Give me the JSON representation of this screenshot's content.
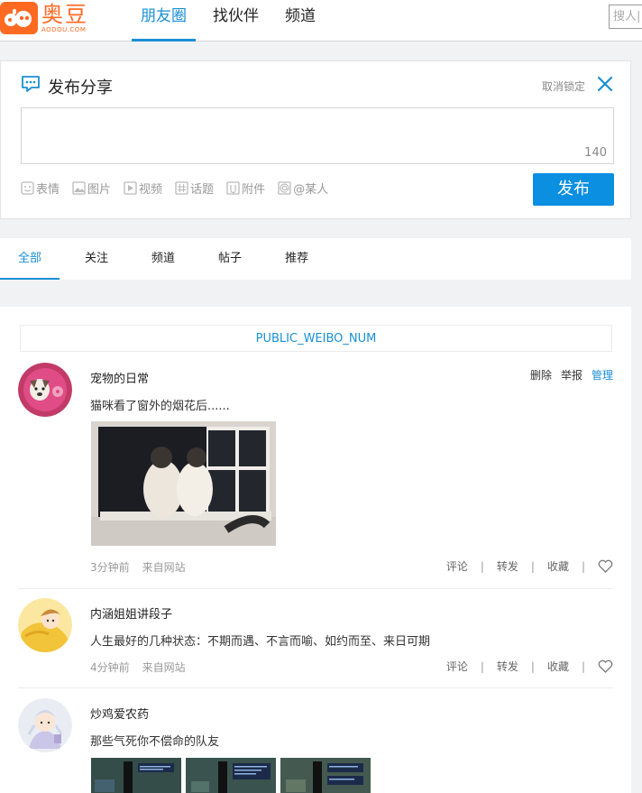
{
  "header": {
    "logo_cn": "奥豆",
    "logo_en": "AODOU.COM",
    "nav": [
      "朋友圈",
      "找伙伴",
      "频道"
    ],
    "search_placeholder": "搜人|"
  },
  "publish": {
    "title": "发布分享",
    "cancel_lock": "取消锁定",
    "counter": "140",
    "tools": [
      {
        "icon": "emoji-icon",
        "label": "表情"
      },
      {
        "icon": "image-icon",
        "label": "图片"
      },
      {
        "icon": "video-icon",
        "label": "视频"
      },
      {
        "icon": "hashtag-icon",
        "label": "话题"
      },
      {
        "icon": "attachment-icon",
        "label": "附件"
      },
      {
        "icon": "at-icon",
        "label": "@某人"
      }
    ],
    "submit_label": "发布"
  },
  "tabs": [
    "全部",
    "关注",
    "频道",
    "帖子",
    "推荐"
  ],
  "feed": {
    "public_num": "PUBLIC_WEIBO_NUM",
    "posts": [
      {
        "user": "宠物的日常",
        "text": "猫咪看了窗外的烟花后......",
        "time": "3分钟前",
        "source": "来自网站",
        "ops": [
          "删除",
          "举报",
          "管理"
        ],
        "actions": [
          "评论",
          "转发",
          "收藏"
        ]
      },
      {
        "user": "内涵姐姐讲段子",
        "text": "人生最好的几种状态：不期而遇、不言而喻、如约而至、来日可期",
        "time": "4分钟前",
        "source": "来自网站",
        "actions": [
          "评论",
          "转发",
          "收藏"
        ]
      },
      {
        "user": "炒鸡爱农药",
        "text": "那些气死你不偿命的队友"
      }
    ]
  },
  "colors": {
    "brand": "#ff6a22",
    "accent": "#1a8fd4",
    "button": "#0b8fe0"
  }
}
